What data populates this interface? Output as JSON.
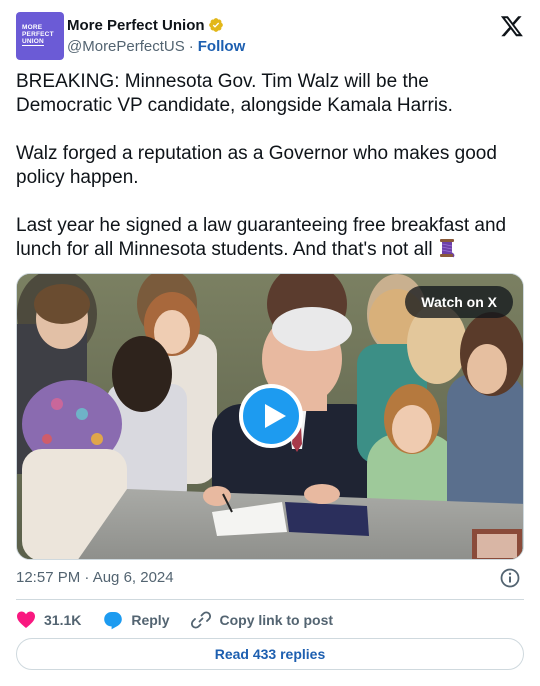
{
  "author": {
    "display_name": "More Perfect Union",
    "handle": "@MorePerfectUS",
    "separator": "·",
    "follow_label": "Follow",
    "avatar_lines": [
      "MORE",
      "PERFECT",
      "UNION"
    ],
    "avatar_color": "#6b5bd6",
    "verified_badge_color": "#e2b719"
  },
  "tweet": {
    "paragraph_1": "BREAKING: Minnesota Gov. Tim Walz will be the Democratic VP candidate, alongside Kamala Harris.",
    "paragraph_2": "Walz forged a reputation as a Governor who makes good policy happen.",
    "paragraph_3": "Last year he signed a law guaranteeing free breakfast and lunch for all Minnesota students. And that's not all",
    "trailing_emoji": "thread-spool-emoji"
  },
  "media": {
    "watch_label": "Watch on X",
    "play_icon": "play-icon"
  },
  "meta": {
    "timestamp": "12:57 PM · Aug 6, 2024"
  },
  "actions": {
    "like_count": "31.1K",
    "reply_label": "Reply",
    "copy_label": "Copy link to post",
    "read_replies_label": "Read 433 replies"
  },
  "colors": {
    "like": "#f91880",
    "reply": "#1d9bf0",
    "link": "#1d5fb0",
    "secondary_text": "#536471",
    "border": "#cfd9de"
  }
}
